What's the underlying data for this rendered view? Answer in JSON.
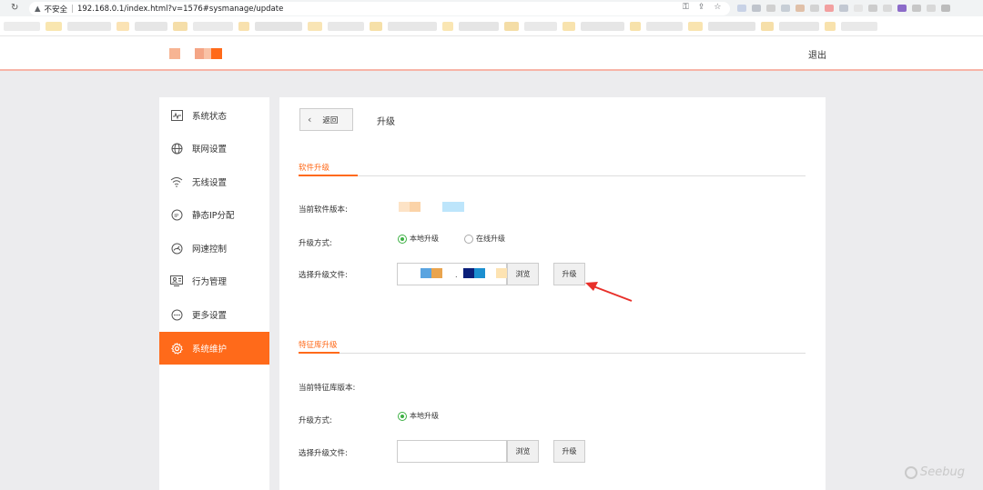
{
  "browser": {
    "reload_icon": "reload-icon",
    "security_label": "不安全",
    "url": "192.168.0.1/index.html?v=1576#sysmanage/update"
  },
  "header": {
    "logout": "退出"
  },
  "sidebar": {
    "items": [
      {
        "label": "系统状态",
        "icon": "activity-icon"
      },
      {
        "label": "联网设置",
        "icon": "globe-icon"
      },
      {
        "label": "无线设置",
        "icon": "wifi-icon"
      },
      {
        "label": "静态IP分配",
        "icon": "ip-icon"
      },
      {
        "label": "网速控制",
        "icon": "speedometer-icon"
      },
      {
        "label": "行为管理",
        "icon": "monitor-user-icon"
      },
      {
        "label": "更多设置",
        "icon": "more-icon"
      },
      {
        "label": "系统维护",
        "icon": "gear-icon",
        "active": true
      }
    ],
    "active_color": "#ff6a1a"
  },
  "main": {
    "back_label": "返回",
    "title": "升级",
    "software": {
      "section_title": "软件升级",
      "version_label": "当前软件版本:",
      "method_label": "升级方式:",
      "option_local": "本地升级",
      "option_online": "在线升级",
      "file_label": "选择升级文件:",
      "file_dot": ".",
      "browse": "浏览",
      "upgrade": "升级"
    },
    "signature": {
      "section_title": "特征库升级",
      "version_label": "当前特征库版本:",
      "method_label": "升级方式:",
      "option_local": "本地升级",
      "file_label": "选择升级文件:",
      "browse": "浏览",
      "upgrade": "升级"
    }
  },
  "watermark": "Seebug",
  "colors": {
    "accent": "#ff6a1a",
    "radio_selected": "#3cb043",
    "annotation_arrow": "#e8302a"
  }
}
